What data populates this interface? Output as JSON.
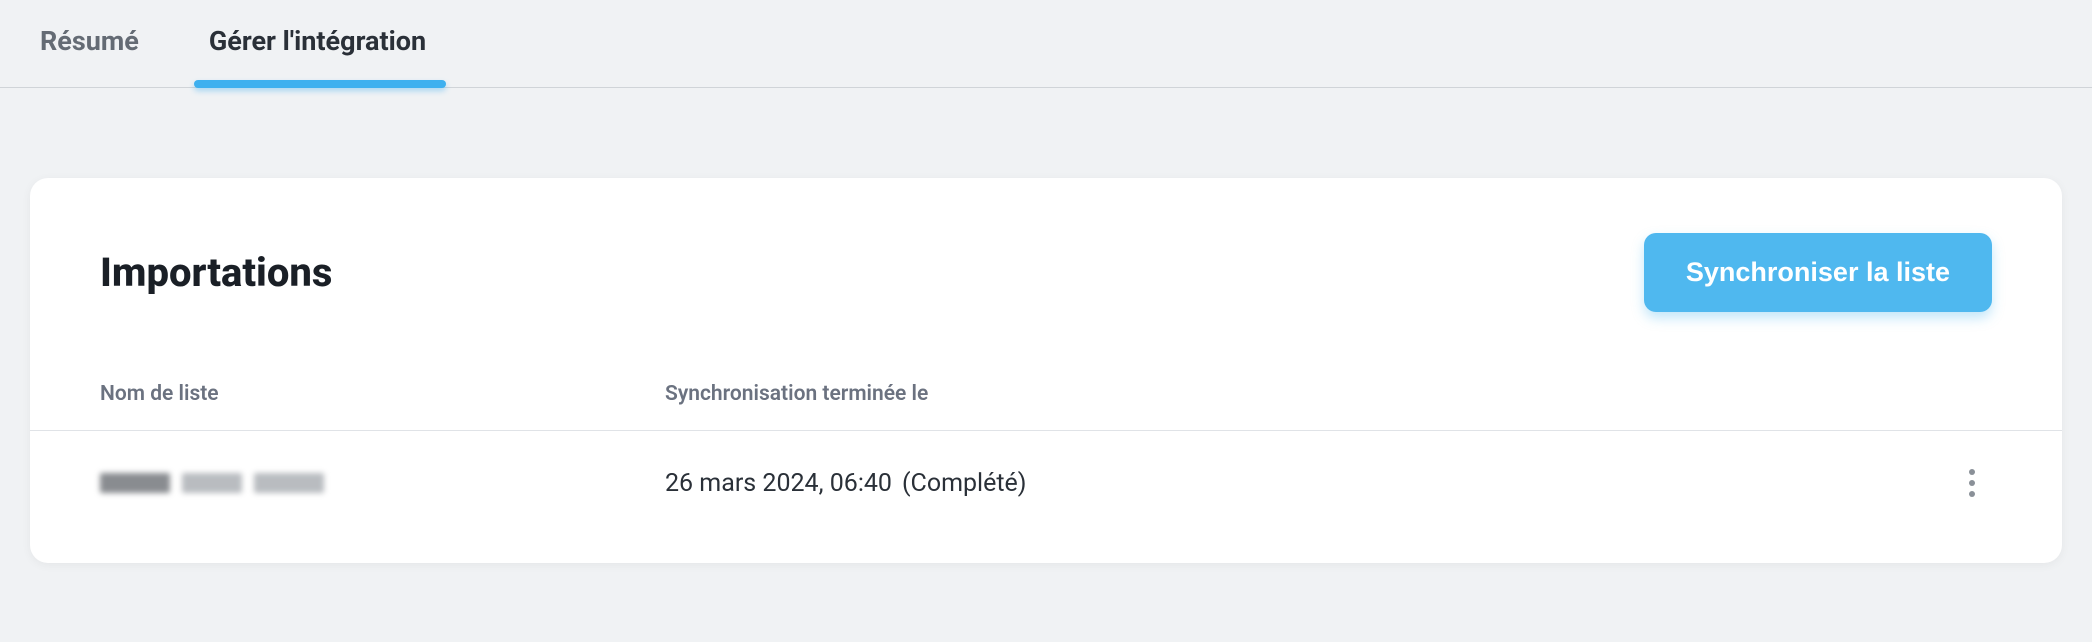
{
  "tabs": {
    "resume": "Résumé",
    "manage": "Gérer l'intégration"
  },
  "card": {
    "title": "Importations",
    "sync_button": "Synchroniser la liste"
  },
  "table": {
    "headers": {
      "list_name": "Nom de liste",
      "sync_completed": "Synchronisation terminée le"
    },
    "rows": [
      {
        "name_redacted": true,
        "sync_date": "26 mars 2024, 06:40",
        "sync_status": "(Complété)"
      }
    ]
  }
}
